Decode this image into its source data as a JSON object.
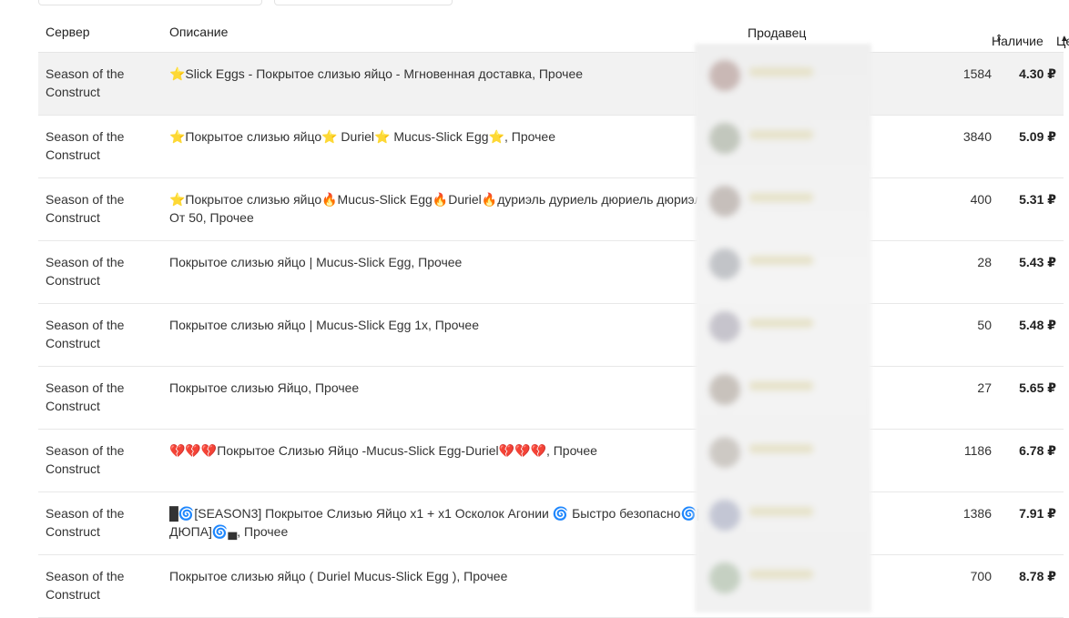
{
  "table": {
    "headers": {
      "server": "Сервер",
      "description": "Описание",
      "seller": "Продавец",
      "stock": "Наличие",
      "price": "Цена"
    },
    "sort_icons": {
      "stock": "sort-both-icon",
      "price": "sort-up-icon"
    },
    "rows": [
      {
        "server": "Season of the Construct",
        "description": "⭐Slick Eggs - Покрытое слизью яйцо - Мгновенная доставка, Прочее",
        "stock": "1584",
        "price": "4.30 ₽",
        "highlighted": true
      },
      {
        "server": "Season of the Construct",
        "description": "⭐Покрытое слизью яйцо⭐ Duriel⭐ Mucus-Slick Egg⭐, Прочее",
        "stock": "3840",
        "price": "5.09 ₽"
      },
      {
        "server": "Season of the Construct",
        "description": "⭐Покрытое слизью яйцо🔥Mucus-Slick Egg🔥Duriel🔥дуриэль дуриель дюриель дюриэль🔥 От 50, Прочее",
        "stock": "400",
        "price": "5.31 ₽"
      },
      {
        "server": "Season of the Construct",
        "description": "Покрытое слизью яйцо | Mucus-Slick Egg, Прочее",
        "stock": "28",
        "price": "5.43 ₽"
      },
      {
        "server": "Season of the Construct",
        "description": "Покрытое слизью яйцо | Mucus-Slick Egg 1x, Прочее",
        "stock": "50",
        "price": "5.48 ₽"
      },
      {
        "server": "Season of the Construct",
        "description": "Покрытое слизью Яйцо, Прочее",
        "stock": "27",
        "price": "5.65 ₽"
      },
      {
        "server": "Season of the Construct",
        "description": "💔💔💔Покрытое Слизью Яйцо -Mucus-Slick Egg-Duriel💔💔💔, Прочее",
        "stock": "1186",
        "price": "6.78 ₽"
      },
      {
        "server": "Season of the Construct",
        "description": "█🌀[SEASON3] Покрытое Слизью Яйцо x1 + x1 Осколок Агонии 🌀 Быстро безопасно🌀[БЕЗ ДЮПА]🌀▄, Прочее",
        "stock": "1386",
        "price": "7.91 ₽"
      },
      {
        "server": "Season of the Construct",
        "description": "Покрытое слизью яйцо ( Duriel Mucus-Slick Egg ), Прочее",
        "stock": "700",
        "price": "8.78 ₽"
      }
    ]
  }
}
